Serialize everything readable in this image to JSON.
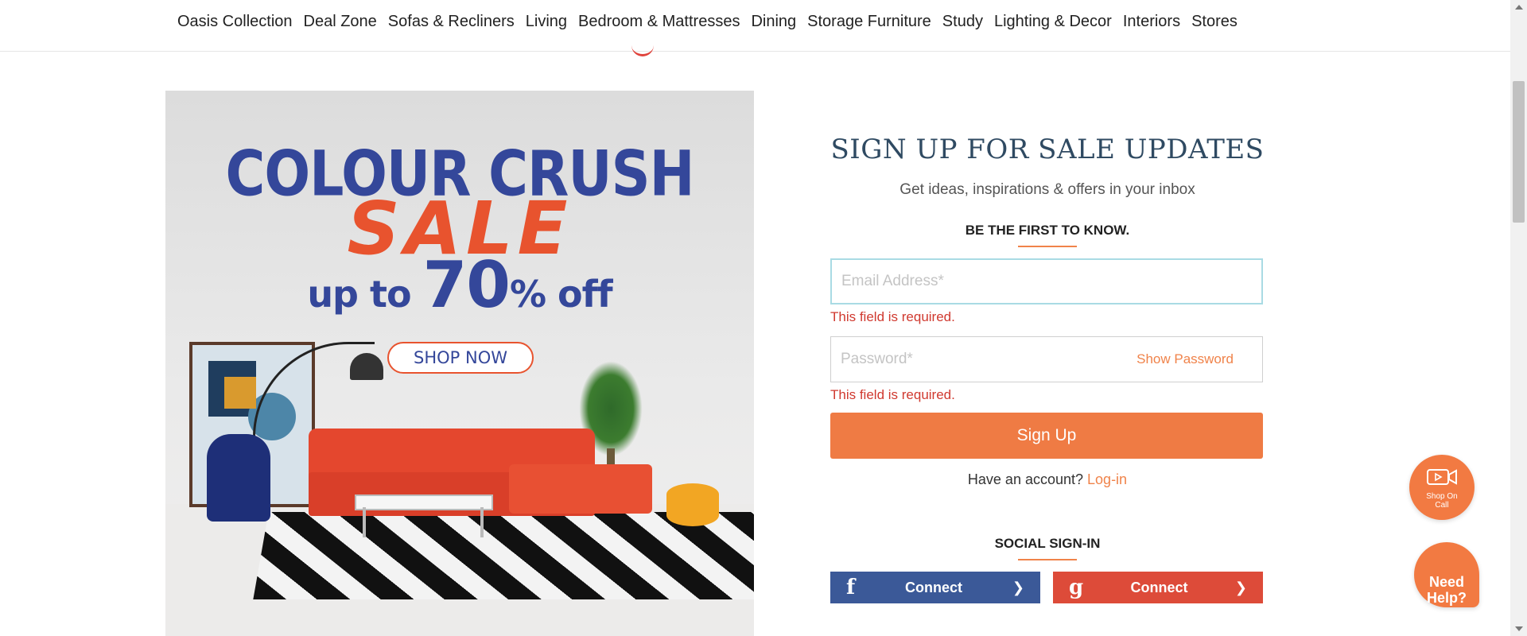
{
  "nav": {
    "items": [
      "Oasis Collection",
      "Deal Zone",
      "Sofas & Recliners",
      "Living",
      "Bedroom & Mattresses",
      "Dining",
      "Storage Furniture",
      "Study",
      "Lighting & Decor",
      "Interiors",
      "Stores"
    ]
  },
  "banner": {
    "line1": "COLOUR CRUSH",
    "line2": "SALE",
    "line3_prefix": "up to",
    "line3_big": "70",
    "line3_suffix": "% off",
    "cta": "SHOP NOW"
  },
  "signup": {
    "title": "SIGN UP FOR SALE UPDATES",
    "subtitle": "Get ideas, inspirations & offers in your inbox",
    "first_to_know": "BE THE FIRST TO KNOW.",
    "email_placeholder": "Email Address*",
    "email_error": "This field is required.",
    "password_placeholder": "Password*",
    "show_password": "Show Password",
    "password_error": "This field is required.",
    "button": "Sign Up",
    "have_account": "Have an account?",
    "login_link": "Log-in",
    "social_title": "SOCIAL SIGN-IN",
    "facebook_label": "Connect",
    "google_label": "Connect"
  },
  "floating": {
    "shop_on_call_line1": "Shop On",
    "shop_on_call_line2": "Call",
    "need_help_line1": "Need",
    "need_help_line2": "Help?"
  },
  "colors": {
    "accent": "#ef7b44",
    "error": "#d0392f",
    "title": "#2f4a62",
    "facebook": "#3b5998",
    "google": "#dd4b39"
  }
}
